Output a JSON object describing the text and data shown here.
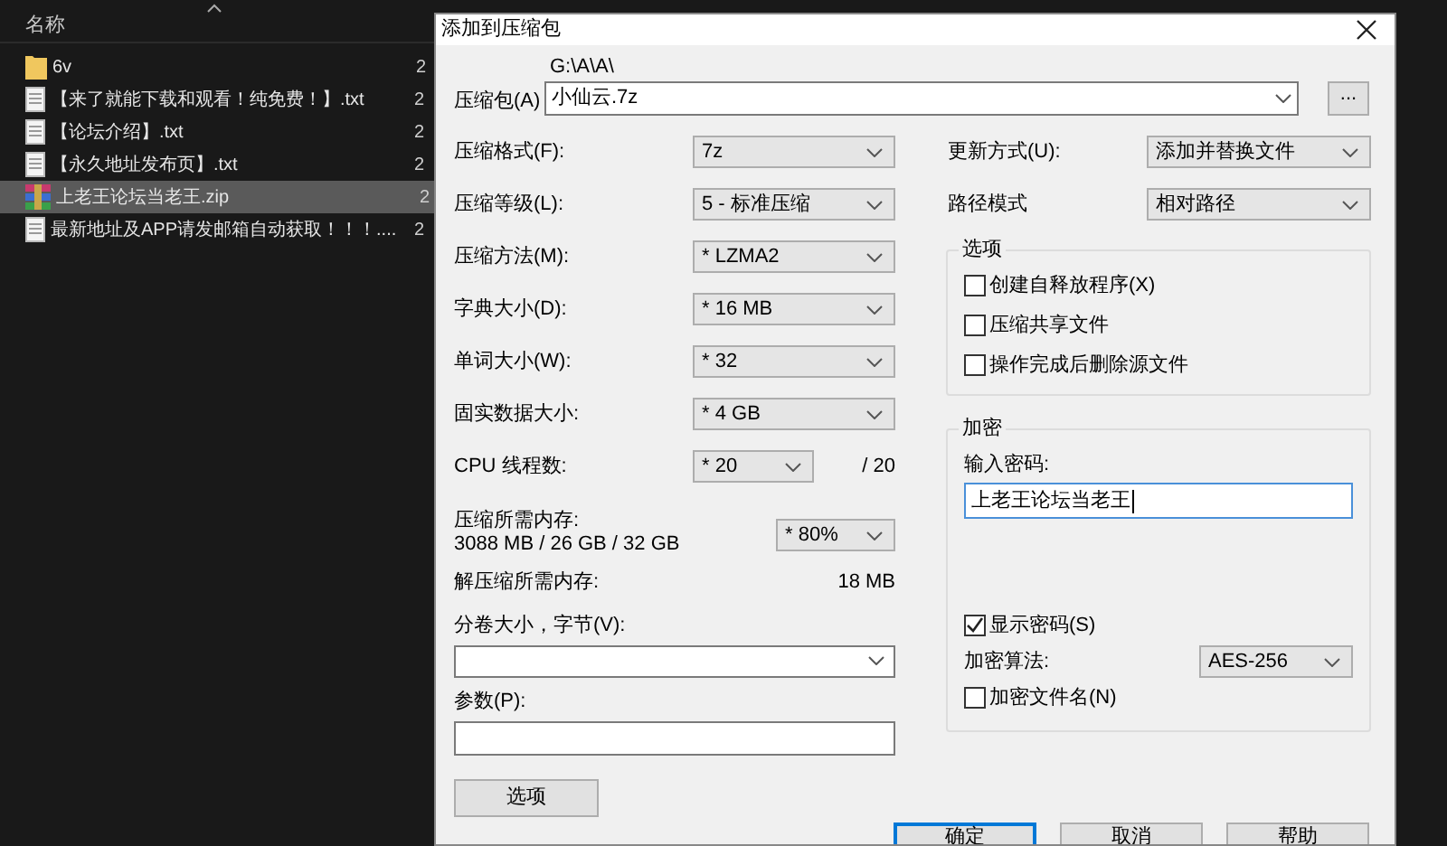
{
  "explorer": {
    "column_header": "名称",
    "files": [
      {
        "name": "6v",
        "kind": "folder",
        "column_2": "2",
        "selected": false
      },
      {
        "name": "【来了就能下载和观看！纯免费！】.txt",
        "kind": "text",
        "column_2": "2",
        "selected": false
      },
      {
        "name": "【论坛介绍】.txt",
        "kind": "text",
        "column_2": "2",
        "selected": false
      },
      {
        "name": "【永久地址发布页】.txt",
        "kind": "text",
        "column_2": "2",
        "selected": false
      },
      {
        "name": "上老王论坛当老王.zip",
        "kind": "archive",
        "column_2": "2",
        "selected": true
      },
      {
        "name": "最新地址及APP请发邮箱自动获取！！！....",
        "kind": "text",
        "column_2": "2",
        "selected": false
      }
    ]
  },
  "dialog": {
    "title": "添加到压缩包",
    "archive": {
      "label": "压缩包(A)",
      "path": "G:\\A\\A\\",
      "value": "小仙云.7z",
      "browse": "..."
    },
    "left_fields": [
      {
        "label": "压缩格式(F):",
        "value": "7z"
      },
      {
        "label": "压缩等级(L):",
        "value": "5 - 标准压缩"
      },
      {
        "label": "压缩方法(M):",
        "value": "* LZMA2"
      },
      {
        "label": "字典大小(D):",
        "value": "* 16 MB"
      },
      {
        "label": "单词大小(W):",
        "value": "* 32"
      },
      {
        "label": "固实数据大小:",
        "value": "* 4 GB"
      },
      {
        "label": "CPU 线程数:",
        "value": "* 20",
        "suffix": "/ 20"
      }
    ],
    "memory": {
      "label": "压缩所需内存:",
      "detail": "3088 MB / 26 GB / 32 GB",
      "value": "* 80%"
    },
    "decompress": {
      "label": "解压缩所需内存:",
      "value": "18 MB"
    },
    "volume": {
      "label": "分卷大小，字节(V):"
    },
    "parameters": {
      "label": "参数(P):"
    },
    "options_button": "选项",
    "right_fields": [
      {
        "label": "更新方式(U):",
        "value": "添加并替换文件"
      },
      {
        "label": "路径模式",
        "value": "相对路径"
      }
    ],
    "options_group": {
      "title": "选项",
      "items": [
        {
          "label": "创建自释放程序(X)",
          "checked": false
        },
        {
          "label": "压缩共享文件",
          "checked": false
        },
        {
          "label": "操作完成后删除源文件",
          "checked": false
        }
      ]
    },
    "encryption": {
      "title": "加密",
      "password_label": "输入密码:",
      "password": "上老王论坛当老王",
      "show_password": {
        "label": "显示密码(S)",
        "checked": true
      },
      "method_label": "加密算法:",
      "method": "AES-256",
      "encrypt_names": {
        "label": "加密文件名(N)",
        "checked": false
      }
    },
    "buttons": [
      {
        "label": "确定",
        "default": true
      },
      {
        "label": "取消",
        "default": false
      },
      {
        "label": "帮助",
        "default": false
      }
    ]
  }
}
